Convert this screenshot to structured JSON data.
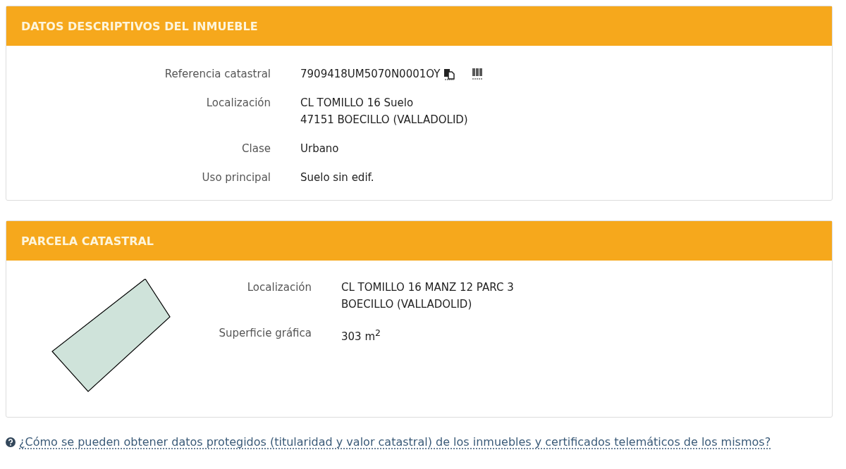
{
  "panels": [
    {
      "kind": "fields",
      "title": "DATOS DESCRIPTIVOS DEL INMUEBLE",
      "rows": [
        {
          "label": "Referencia catastral",
          "lines": [
            "7909418UM5070N0001OY"
          ],
          "icons": true
        },
        {
          "label": "Localización",
          "lines": [
            "CL TOMILLO 16 Suelo",
            "47151 BOECILLO (VALLADOLID)"
          ]
        },
        {
          "label": "Clase",
          "lines": [
            "Urbano"
          ]
        },
        {
          "label": "Uso principal",
          "lines": [
            "Suelo sin edif."
          ]
        }
      ]
    },
    {
      "kind": "parcel",
      "title": "PARCELA CATASTRAL",
      "rows": [
        {
          "label": "Localización",
          "lines": [
            "CL TOMILLO 16 MANZ 12 PARC 3",
            "BOECILLO (VALLADOLID)"
          ]
        },
        {
          "label": "Superficie gráfica",
          "lines": [
            "303 m$^{2}$"
          ]
        }
      ]
    }
  ],
  "help_link": "¿Cómo se pueden obtener datos protegidos (titularidad y valor catastral) de los inmuebles y certificados telemáticos de los mismos?"
}
